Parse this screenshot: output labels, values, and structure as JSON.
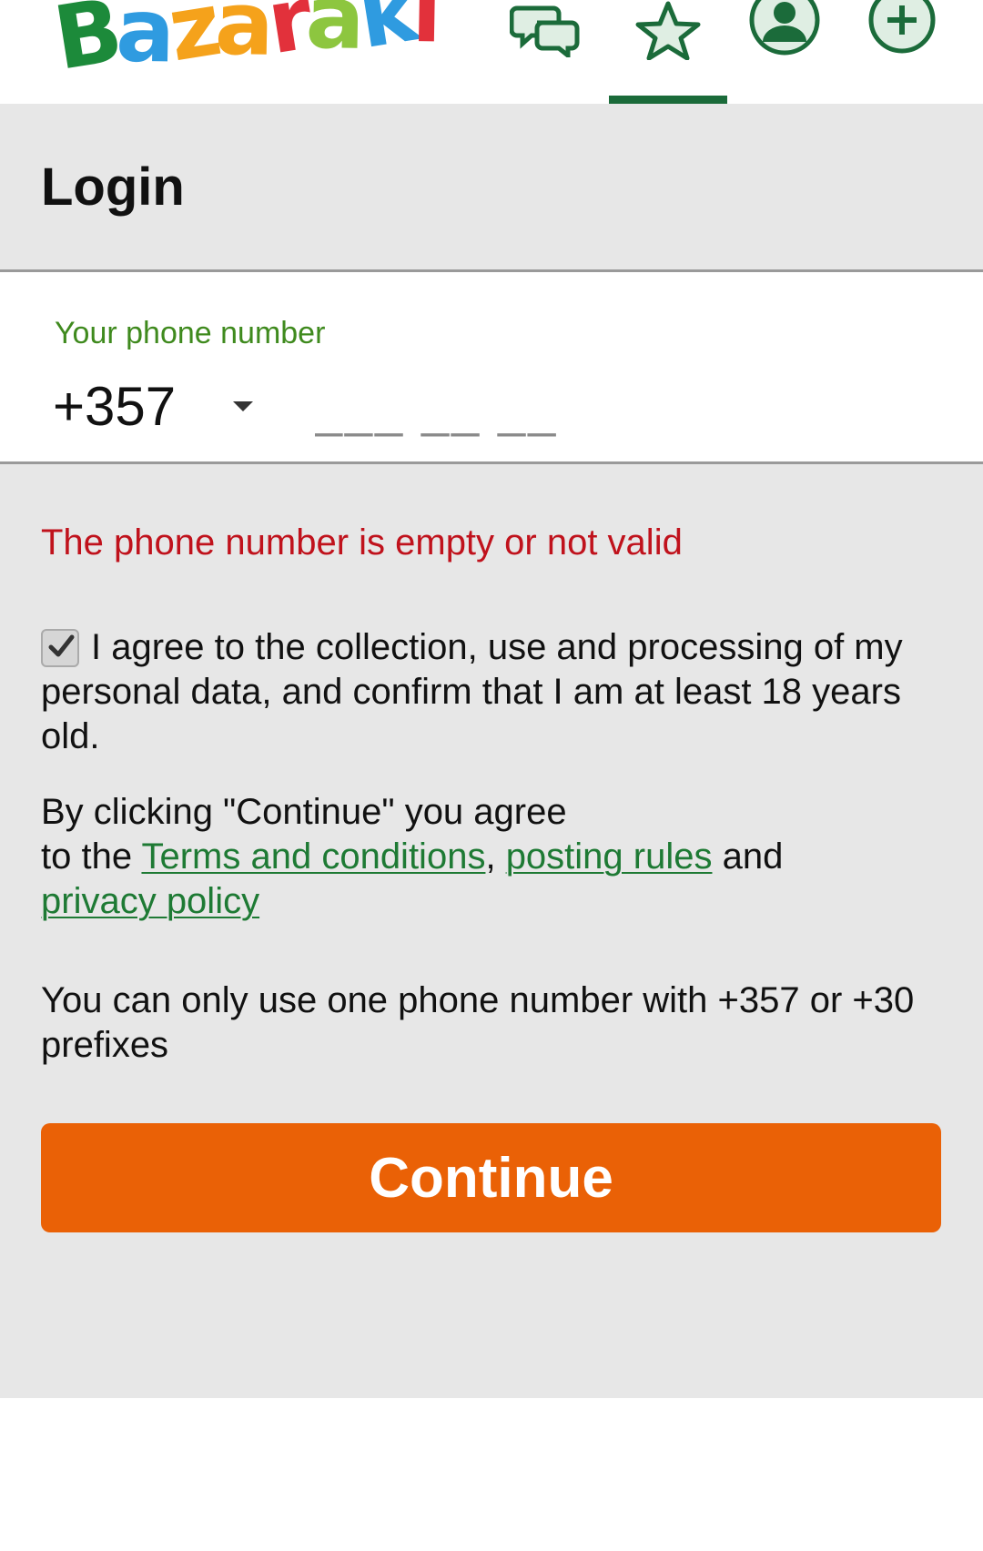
{
  "header": {
    "logo": [
      "B",
      "a",
      "z",
      "a",
      "r",
      "a",
      "k",
      "i"
    ],
    "logo_colors": [
      "#1c8a3a",
      "#2f9be0",
      "#f5a21b",
      "#f5a21b",
      "#e2313b",
      "#8dc63f",
      "#2f9be0",
      "#e2313b"
    ],
    "nav": [
      {
        "icon": "chat-bubbles-icon"
      },
      {
        "icon": "star-icon",
        "active": true
      },
      {
        "icon": "user-profile-icon"
      },
      {
        "icon": "plus-circle-icon"
      }
    ]
  },
  "page": {
    "title": "Login"
  },
  "phone": {
    "label": "Your phone number",
    "prefix": "+357",
    "placeholder": "___ __ __"
  },
  "error": "The phone number is empty or not valid",
  "consent": {
    "checked": true,
    "text": "I agree to the collection, use and processing of my personal data, and confirm that I am at least 18 years old."
  },
  "terms": {
    "prefix_line": "By clicking \"Continue\" you agree",
    "to_the": "to the ",
    "terms_link": "Terms and conditions",
    "comma": ",",
    "posting_link": "posting rules",
    "and": " and",
    "privacy_link": "privacy policy"
  },
  "notice": "You can only use one phone number with +357 or +30 prefixes",
  "continue_label": "Continue",
  "colors": {
    "accent_green": "#1b6b3a",
    "label_green": "#3f8a1e",
    "link_green": "#1e7a34",
    "error_red": "#c0121c",
    "button_orange": "#ea6106",
    "background_gray": "#e7e7e7"
  }
}
